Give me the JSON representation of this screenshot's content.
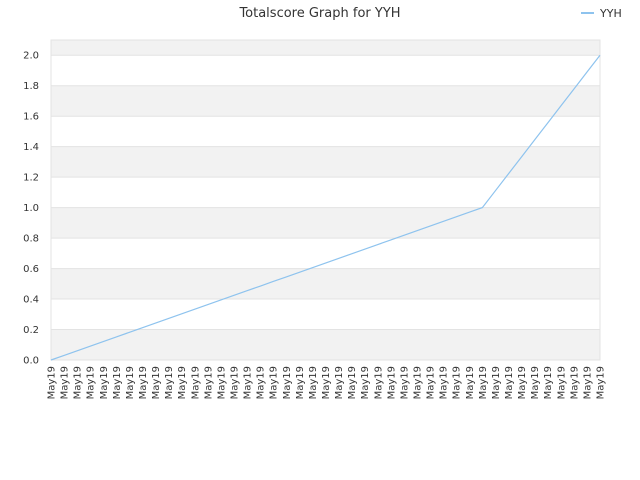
{
  "chart_data": {
    "type": "line",
    "title": "Totalscore Graph for YYH",
    "xlabel": "",
    "ylabel": "",
    "ylim": [
      0,
      2.1
    ],
    "yticks": [
      "0.0",
      "0.2",
      "0.4",
      "0.6",
      "0.8",
      "1.0",
      "1.2",
      "1.4",
      "1.6",
      "1.8",
      "2.0"
    ],
    "categories": [
      "May19",
      "May19",
      "May19",
      "May19",
      "May19",
      "May19",
      "May19",
      "May19",
      "May19",
      "May19",
      "May19",
      "May19",
      "May19",
      "May19",
      "May19",
      "May19",
      "May19",
      "May19",
      "May19",
      "May19",
      "May19",
      "May19",
      "May19",
      "May19",
      "May19",
      "May19",
      "May19",
      "May19",
      "May19",
      "May19",
      "May19",
      "May19",
      "May19",
      "May19",
      "May19",
      "May19",
      "May19",
      "May19",
      "May19",
      "May19",
      "May19",
      "May19",
      "May19"
    ],
    "series": [
      {
        "name": "YYH",
        "color": "#8ec3ee",
        "values": [
          0,
          0.0303,
          0.0606,
          0.0909,
          0.1212,
          0.1515,
          0.1818,
          0.2121,
          0.2424,
          0.2727,
          0.303,
          0.3333,
          0.3636,
          0.3939,
          0.4242,
          0.4545,
          0.4848,
          0.5152,
          0.5455,
          0.5758,
          0.6061,
          0.6364,
          0.6667,
          0.697,
          0.7273,
          0.7576,
          0.7879,
          0.8182,
          0.8485,
          0.8788,
          0.9091,
          0.9394,
          0.9697,
          1.0,
          1.1111,
          1.2222,
          1.3333,
          1.4444,
          1.5556,
          1.6667,
          1.7778,
          1.8889,
          2.0
        ]
      }
    ],
    "legend": "top-right",
    "grid": true,
    "band_colors": [
      "#f2f2f2",
      "#ffffff"
    ]
  }
}
